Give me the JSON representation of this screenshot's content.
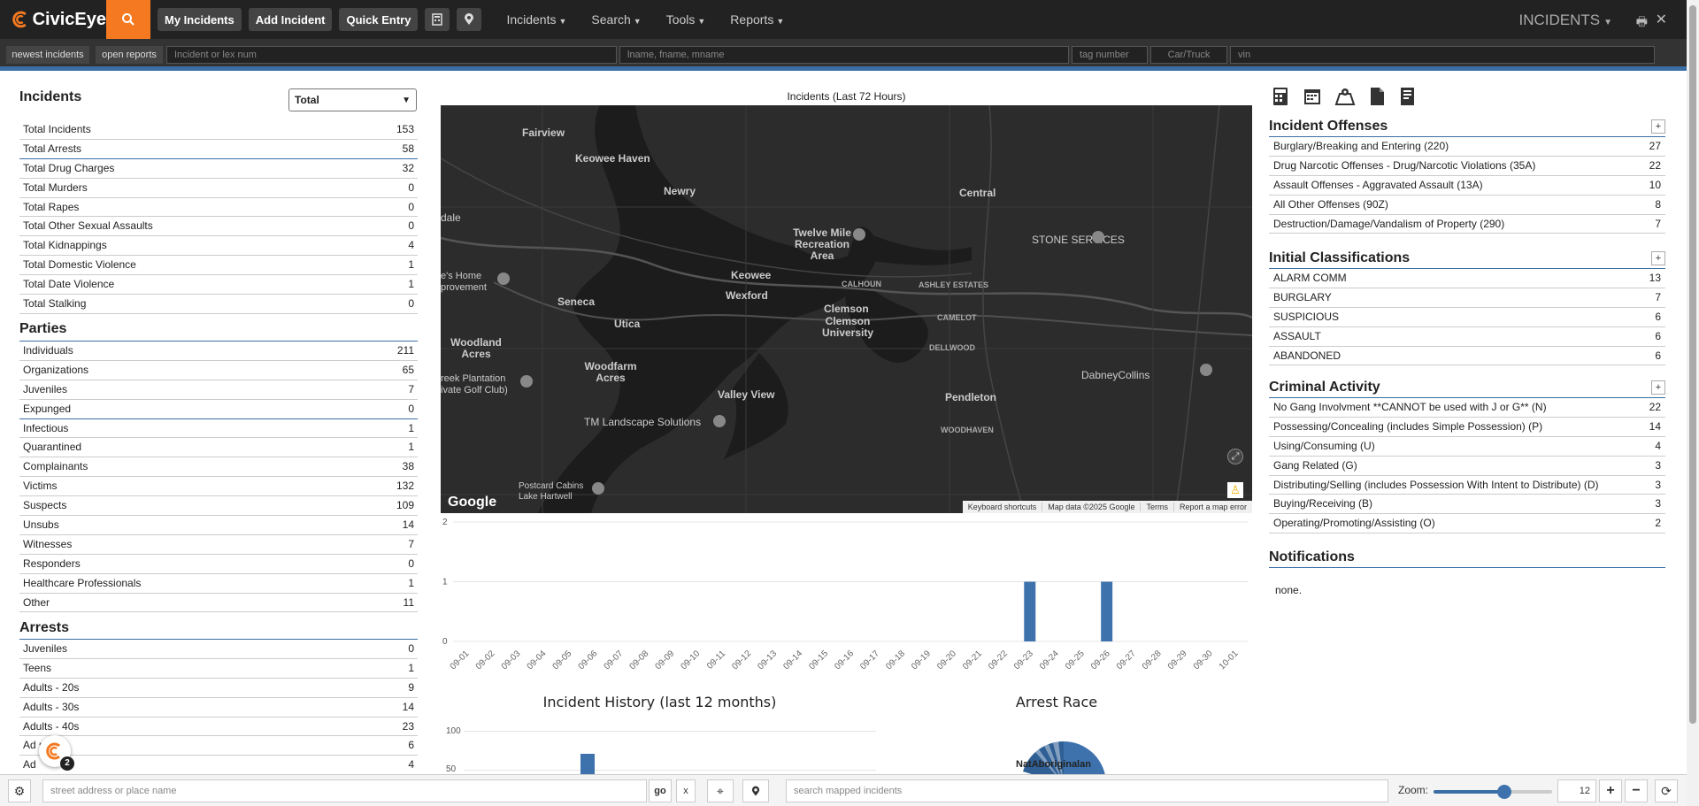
{
  "app": {
    "name": "CivicEye",
    "page_title": "INCIDENTS",
    "badge": "2"
  },
  "nav": {
    "buttons": [
      "My Incidents",
      "Add Incident",
      "Quick Entry"
    ],
    "menus": [
      "Incidents",
      "Search",
      "Tools",
      "Reports"
    ]
  },
  "filters": {
    "newest": "newest incidents",
    "open": "open reports",
    "incident_ph": "Incident or lex num",
    "name_ph": "lname, fname, mname",
    "tag_ph": "tag number",
    "car_ph": "Car/Truck",
    "vin_ph": "vin"
  },
  "incidents": {
    "title": "Incidents",
    "select": "Total",
    "rows": [
      {
        "label": "Total Incidents",
        "value": "153"
      },
      {
        "label": "Total Arrests",
        "value": "58"
      },
      {
        "label": "Total Drug Charges",
        "value": "32"
      },
      {
        "label": "Total Murders",
        "value": "0"
      },
      {
        "label": "Total Rapes",
        "value": "0"
      },
      {
        "label": "Total Other Sexual Assaults",
        "value": "0"
      },
      {
        "label": "Total Kidnappings",
        "value": "4"
      },
      {
        "label": "Total Domestic Violence",
        "value": "1"
      },
      {
        "label": "Total Date Violence",
        "value": "1"
      },
      {
        "label": "Total Stalking",
        "value": "0"
      }
    ]
  },
  "parties": {
    "title": "Parties",
    "rows": [
      {
        "label": "Individuals",
        "value": "211"
      },
      {
        "label": "Organizations",
        "value": "65"
      },
      {
        "label": "Juveniles",
        "value": "7"
      },
      {
        "label": "Expunged",
        "value": "0"
      },
      {
        "label": "Infectious",
        "value": "1"
      },
      {
        "label": "Quarantined",
        "value": "1"
      },
      {
        "label": "Complainants",
        "value": "38"
      },
      {
        "label": "Victims",
        "value": "132"
      },
      {
        "label": "Suspects",
        "value": "109"
      },
      {
        "label": "Unsubs",
        "value": "14"
      },
      {
        "label": "Witnesses",
        "value": "7"
      },
      {
        "label": "Responders",
        "value": "0"
      },
      {
        "label": "Healthcare Professionals",
        "value": "1"
      },
      {
        "label": "Other",
        "value": "11"
      }
    ]
  },
  "arrests": {
    "title": "Arrests",
    "rows": [
      {
        "label": "Juveniles",
        "value": "0"
      },
      {
        "label": "Teens",
        "value": "1"
      },
      {
        "label": "Adults - 20s",
        "value": "9"
      },
      {
        "label": "Adults - 30s",
        "value": "14"
      },
      {
        "label": "Adults - 40s",
        "value": "23"
      },
      {
        "label": "Ad s",
        "value": "6"
      },
      {
        "label": "Ad",
        "value": "4"
      }
    ]
  },
  "map": {
    "title": "Incidents (Last 72 Hours)",
    "labels": [
      "Fairview",
      "Keowee Haven",
      "Newry",
      "Central",
      "Twelve Mile Recreation Area",
      "STONE SERVICES",
      "Keowee",
      "Wexford",
      "Seneca",
      "Utica",
      "Clemson",
      "Clemson University",
      "Woodland Acres",
      "Woodfarm Acres",
      "Valley View",
      "Pendleton",
      "TM Landscape Solutions",
      "DabneyCollins",
      "Postcard Cabins Lake Hartwell",
      "CALHOUN",
      "ASHLEY ESTATES",
      "CAMELOT",
      "DELLWOOD",
      "WOODHAVEN",
      "dale",
      "e's Home provement",
      "reek Plantation ivate Golf Club)"
    ],
    "footer": [
      "Keyboard shortcuts",
      "Map data ©2025 Google",
      "Terms",
      "Report a map error"
    ],
    "google": "Google"
  },
  "chart_data": {
    "type": "bar",
    "categories": [
      "09-01",
      "09-02",
      "09-03",
      "09-04",
      "09-05",
      "09-06",
      "09-07",
      "09-08",
      "09-09",
      "09-10",
      "09-11",
      "09-12",
      "09-13",
      "09-14",
      "09-15",
      "09-16",
      "09-17",
      "09-18",
      "09-19",
      "09-20",
      "09-21",
      "09-22",
      "09-23",
      "09-24",
      "09-25",
      "09-26",
      "09-27",
      "09-28",
      "09-29",
      "09-30",
      "10-01"
    ],
    "values": [
      0,
      0,
      0,
      0,
      0,
      0,
      0,
      0,
      0,
      0,
      0,
      0,
      0,
      0,
      0,
      0,
      0,
      0,
      0,
      0,
      0,
      0,
      1,
      0,
      0,
      1,
      0,
      0,
      0,
      0,
      0
    ],
    "ylim": [
      0,
      2
    ],
    "yticks": [
      "0",
      "1",
      "2"
    ],
    "color": "#3d72ad"
  },
  "history": {
    "title": "Incident History (last 12 months)",
    "ticks": [
      "100",
      "50"
    ]
  },
  "race": {
    "title": "Arrest Race",
    "label": "NatAboriginalan"
  },
  "offenses": {
    "title": "Incident Offenses",
    "rows": [
      {
        "label": "Burglary/Breaking and Entering (220)",
        "value": "27"
      },
      {
        "label": "Drug Narcotic Offenses - Drug/Narcotic Violations (35A)",
        "value": "22"
      },
      {
        "label": "Assault Offenses - Aggravated Assault (13A)",
        "value": "10"
      },
      {
        "label": "All Other Offenses (90Z)",
        "value": "8"
      },
      {
        "label": "Destruction/Damage/Vandalism of Property (290)",
        "value": "7"
      }
    ]
  },
  "classifications": {
    "title": "Initial Classifications",
    "rows": [
      {
        "label": "ALARM COMM",
        "value": "13"
      },
      {
        "label": "BURGLARY",
        "value": "7"
      },
      {
        "label": "SUSPICIOUS",
        "value": "6"
      },
      {
        "label": "ASSAULT",
        "value": "6"
      },
      {
        "label": "ABANDONED",
        "value": "6"
      }
    ]
  },
  "criminal": {
    "title": "Criminal Activity",
    "rows": [
      {
        "label": "No Gang Involvment **CANNOT be used with J or G** (N)",
        "value": "22"
      },
      {
        "label": "Possessing/Concealing (includes Simple Possession) (P)",
        "value": "14"
      },
      {
        "label": "Using/Consuming (U)",
        "value": "4"
      },
      {
        "label": "Gang Related (G)",
        "value": "3"
      },
      {
        "label": "Distributing/Selling (includes Possession With Intent to Distribute) (D)",
        "value": "3"
      },
      {
        "label": "Buying/Receiving (B)",
        "value": "3"
      },
      {
        "label": "Operating/Promoting/Assisting (O)",
        "value": "2"
      }
    ]
  },
  "notifications": {
    "title": "Notifications",
    "text": "none."
  },
  "bottom": {
    "address_ph": "street address or place name",
    "go": "go",
    "x": "x",
    "search_ph": "search mapped incidents",
    "zoom_label": "Zoom:",
    "zoom": "12",
    "zoom_fraction": 0.6
  }
}
